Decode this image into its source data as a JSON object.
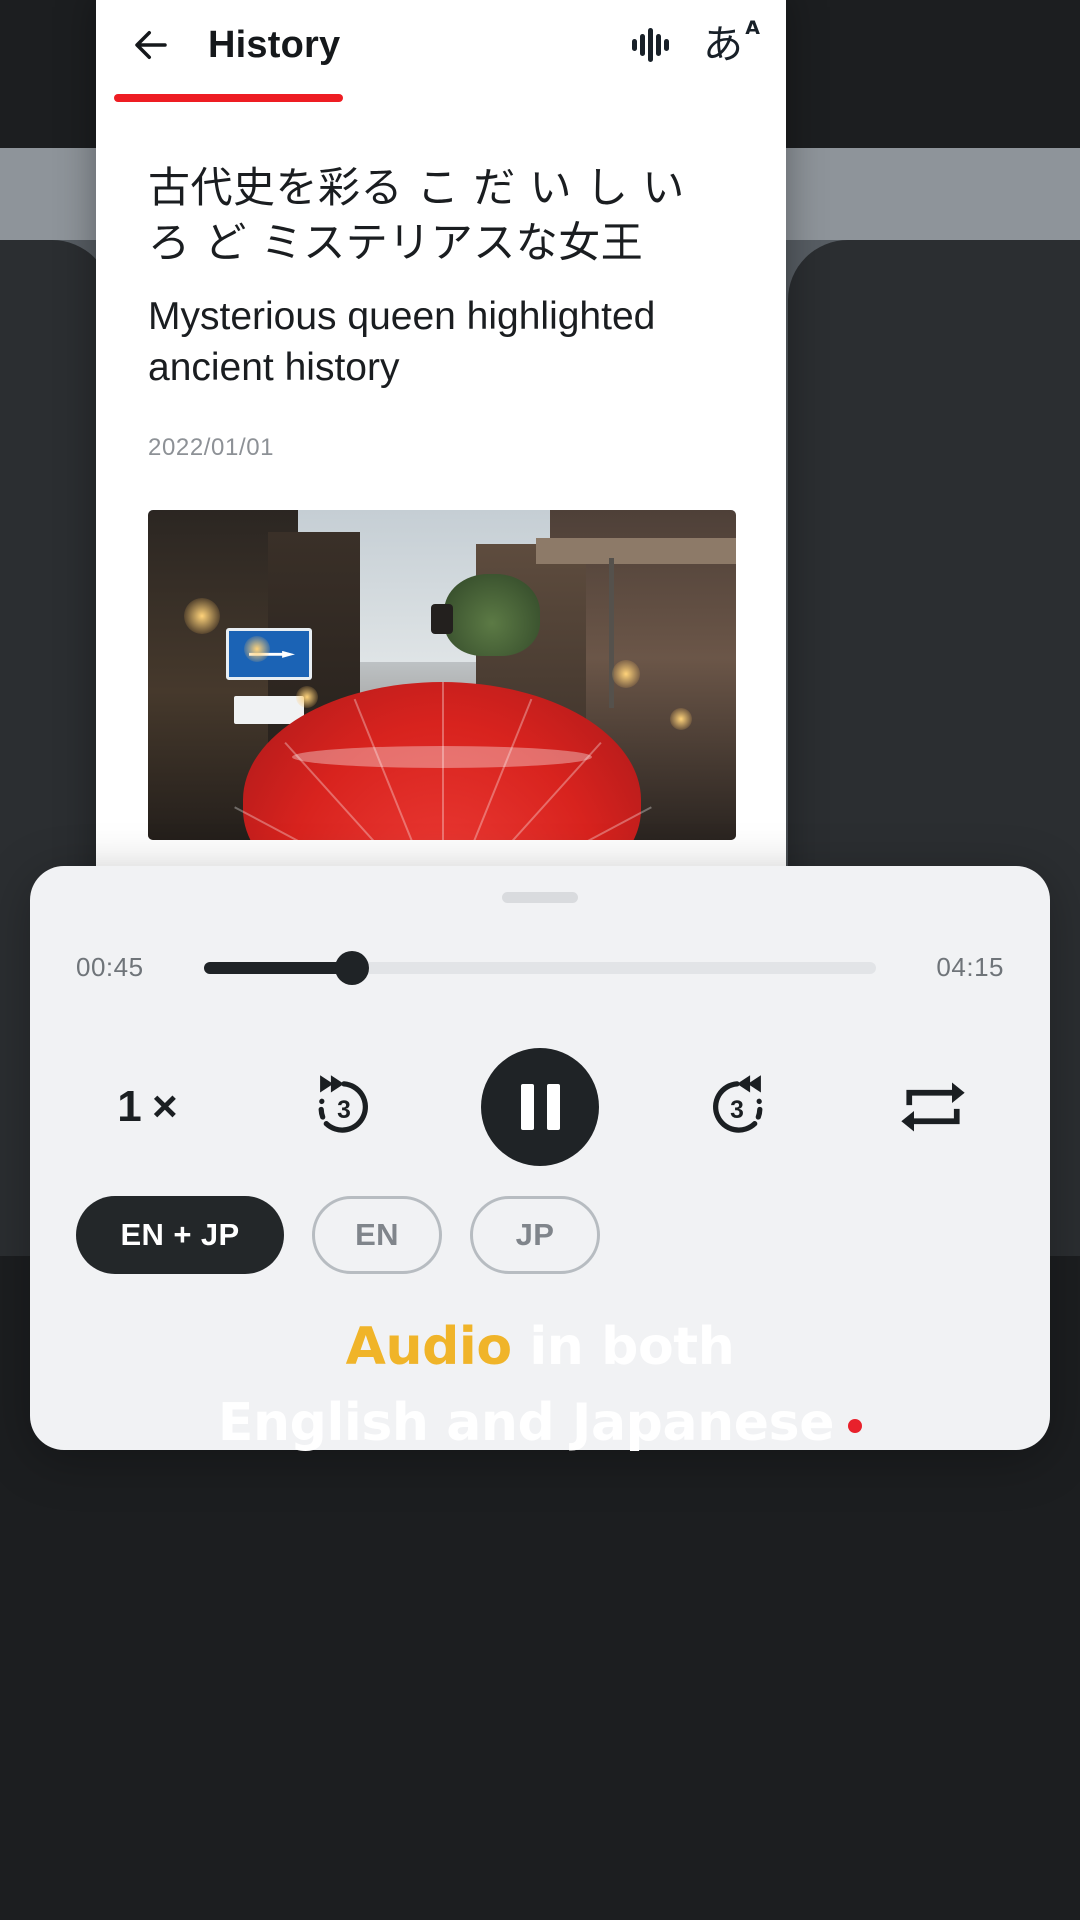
{
  "app": {
    "header": {
      "title": "History",
      "back_icon": "arrow-left-icon",
      "waveform_icon": "audio-waveform-icon",
      "furigana_icon": "あ",
      "furigana_sup": "A",
      "accent_color": "#ee1d23"
    },
    "article": {
      "jp_title": "古代史を彩る こ だ い し い ろ ど ミステリアスな女王",
      "en_title": "Mysterious queen highlighted ancient history",
      "date": "2022/01/01",
      "hero_alt": "red-japanese-umbrella-street-photo"
    }
  },
  "player": {
    "current_time": "00:45",
    "total_time": "04:15",
    "progress_percent": 22,
    "controls": {
      "speed_label": "1 ×",
      "rewind_label": "replay-3-seconds-icon",
      "play_state_icon": "pause-icon",
      "forward_label": "forward-3-seconds-icon",
      "repeat_label": "repeat-icon"
    },
    "language_pills": [
      {
        "label": "EN + JP",
        "active": true
      },
      {
        "label": "EN",
        "active": false
      },
      {
        "label": "JP",
        "active": false
      }
    ]
  },
  "caption": {
    "line1_accent": "Audio",
    "line1_rest": " in both",
    "line2": "English and Japanese",
    "accent_color": "#f0b429",
    "dot_color": "#e8212b"
  }
}
